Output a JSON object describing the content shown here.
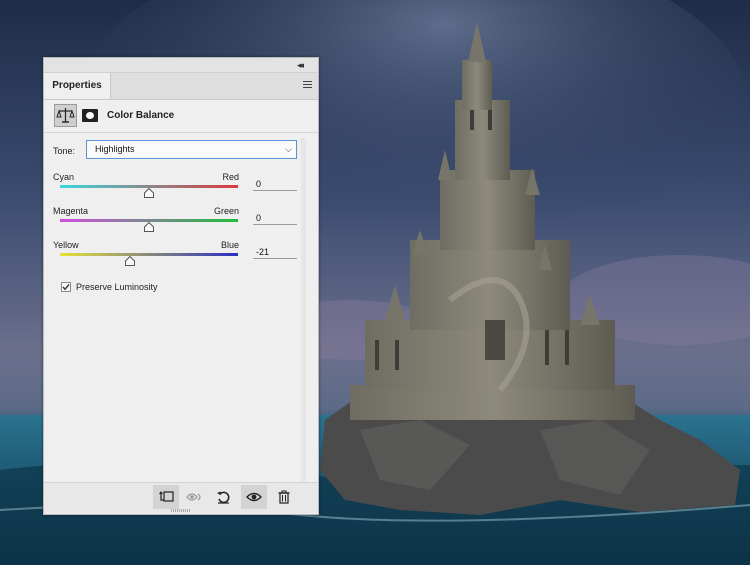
{
  "panel": {
    "tab_label": "Properties",
    "header_title": "Color Balance",
    "tone": {
      "label": "Tone:",
      "value": "Highlights"
    },
    "sliders": [
      {
        "left": "Cyan",
        "right": "Red",
        "value": "0",
        "level": 0.5,
        "gradient": [
          "#3bd6e0",
          "#d93a3a"
        ]
      },
      {
        "left": "Magenta",
        "right": "Green",
        "value": "0",
        "level": 0.5,
        "gradient": [
          "#d24fe0",
          "#1fbf3a"
        ]
      },
      {
        "left": "Yellow",
        "right": "Blue",
        "value": "-21",
        "level": 0.395,
        "gradient": [
          "#e6e23a",
          "#2a2fbf"
        ]
      }
    ],
    "preserve_luminosity": {
      "label": "Preserve Luminosity",
      "checked": true
    },
    "footer_icons": [
      "clip-to-layer-icon",
      "view-previous-state-icon",
      "reset-icon",
      "visibility-icon",
      "delete-icon"
    ]
  },
  "colors": {
    "accent_border": "#5b8fd6",
    "panel_bg": "#efefef"
  }
}
